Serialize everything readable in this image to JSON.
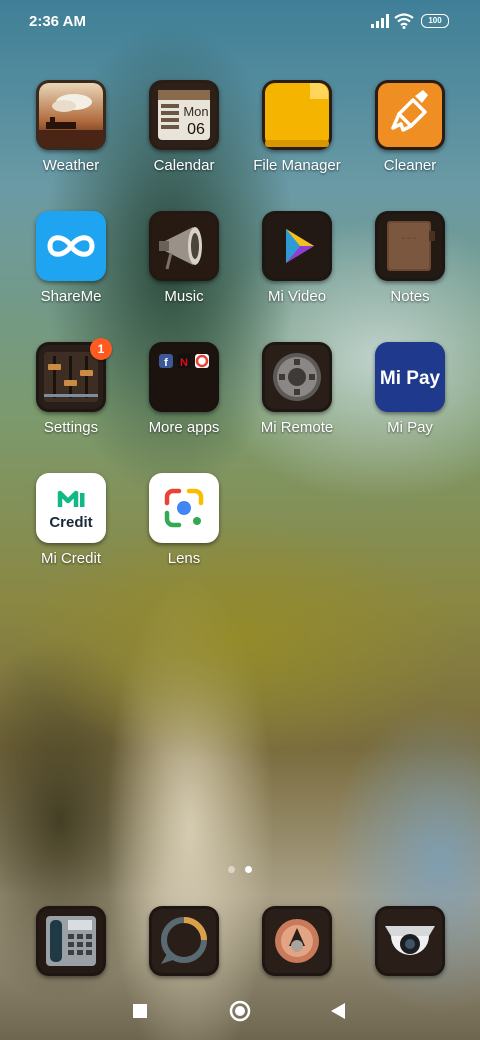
{
  "status_bar": {
    "time": "2:36 AM",
    "battery": "100"
  },
  "apps": [
    {
      "label": "Weather",
      "icon": "weather-icon"
    },
    {
      "label": "Calendar",
      "icon": "calendar-icon",
      "day": "Mon",
      "date": "06"
    },
    {
      "label": "File Manager",
      "icon": "folder-icon"
    },
    {
      "label": "Cleaner",
      "icon": "broom-icon"
    },
    {
      "label": "ShareMe",
      "icon": "infinity-icon"
    },
    {
      "label": "Music",
      "icon": "megaphone-icon"
    },
    {
      "label": "Mi Video",
      "icon": "play-icon"
    },
    {
      "label": "Notes",
      "icon": "notebook-icon"
    },
    {
      "label": "Settings",
      "icon": "sliders-icon",
      "badge": "1"
    },
    {
      "label": "More apps",
      "icon": "app-folder-icon"
    },
    {
      "label": "Mi Remote",
      "icon": "remote-dial-icon"
    },
    {
      "label": "Mi Pay",
      "icon": "mipay-icon",
      "icon_text": "Mi Pay"
    },
    {
      "label": "Mi Credit",
      "icon": "mi-credit-icon",
      "icon_text": "Credit"
    },
    {
      "label": "Lens",
      "icon": "lens-icon"
    }
  ],
  "page_indicator": {
    "pages": 2,
    "current": 2
  },
  "dock": [
    {
      "icon": "phone-icon"
    },
    {
      "icon": "messages-icon"
    },
    {
      "icon": "browser-icon"
    },
    {
      "icon": "camera-icon"
    }
  ],
  "nav_bar": {
    "recents_icon": "square-icon",
    "home_icon": "circle-icon",
    "back_icon": "triangle-icon"
  },
  "colors": {
    "badge": "#ff5a1f",
    "file_manager": "#f5b400",
    "cleaner": "#ef8e22",
    "shareme": "#1ea4f0",
    "mipay": "#1f3a8c",
    "mi_credit": "#12b886"
  }
}
